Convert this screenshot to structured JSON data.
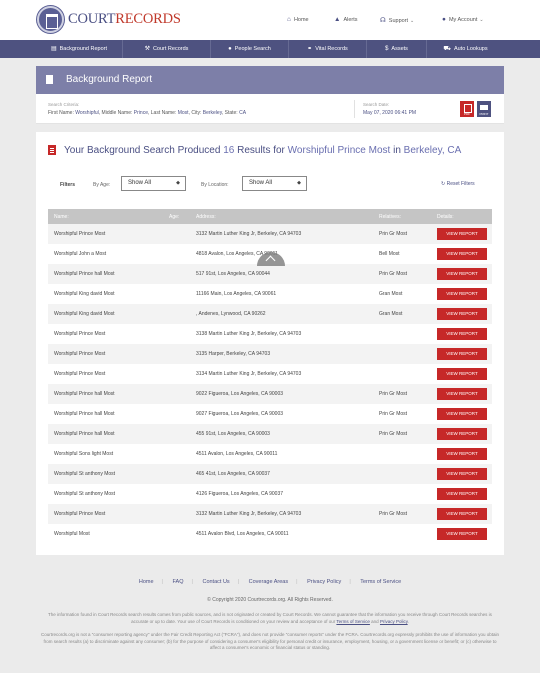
{
  "header": {
    "logo_part1": "COURT",
    "logo_part2": "RECORDS",
    "nav": [
      {
        "label": "Home",
        "icon": "home-icon"
      },
      {
        "label": "Alerts",
        "icon": "alert-icon"
      },
      {
        "label": "Support",
        "icon": "headset-icon"
      },
      {
        "label": "My Account",
        "icon": "user-icon"
      }
    ]
  },
  "main_nav": [
    {
      "label": "Background Report",
      "icon": "document-icon"
    },
    {
      "label": "Court Records",
      "icon": "gavel-icon"
    },
    {
      "label": "People Search",
      "icon": "person-icon"
    },
    {
      "label": "Vital Records",
      "icon": "link-icon"
    },
    {
      "label": "Assets",
      "icon": "dollar-icon"
    },
    {
      "label": "Auto Lookups",
      "icon": "car-icon"
    }
  ],
  "report": {
    "title": "Background Report",
    "criteria_label": "Search Criteria:",
    "criteria": {
      "first_name_label": "First Name:",
      "first_name": "Worshipful",
      "middle_name_label": "Middle Name:",
      "middle_name": "Prince",
      "last_name_label": "Last Name:",
      "last_name": "Most",
      "city_label": "City:",
      "city": "Berkeley",
      "state_label": "State:",
      "state": "CA"
    },
    "date_label": "Search Date:",
    "date_value": "May 07, 2020 06:41 PM",
    "pdf_label": "PDF",
    "print_label": "PRINT"
  },
  "results": {
    "title_prefix": "Your Background Search Produced",
    "count": "16",
    "title_mid": "Results for",
    "query_name": "Worshipful Prince Most",
    "title_in": "in",
    "query_location": "Berkeley, CA",
    "filters_label": "Filters",
    "by_age_label": "By Age:",
    "by_age_value": "Show All",
    "by_location_label": "By Location:",
    "by_location_value": "Show All",
    "reset_label": "Reset Filters",
    "columns": [
      "Name:",
      "Age:",
      "Address:",
      "Relatives:",
      "Details:"
    ],
    "view_label": "VIEW REPORT",
    "rows": [
      {
        "name": "Worshipful Prince Most",
        "address": "3132 Martin Luther King Jr, Berkeley, CA 94703",
        "relatives": "Prin Gr Most"
      },
      {
        "name": "Worshipful John a Most",
        "address": "4818 Avalon, Los Angeles, CA 90011",
        "relatives": "Bell Most"
      },
      {
        "name": "Worshipful Prince hall Most",
        "address": "517 91st, Los Angeles, CA 90044",
        "relatives": "Prin Gr Most"
      },
      {
        "name": "Worshipful King david Most",
        "address": "11166 Main, Los Angeles, CA 90061",
        "relatives": "Gran Most"
      },
      {
        "name": "Worshipful King david Most",
        "address": ", Andenes, Lynwood, CA 90262",
        "relatives": "Gran Most"
      },
      {
        "name": "Worshipful Prince Most",
        "address": "3138 Martin Luther King Jr, Berkeley, CA 94703",
        "relatives": ""
      },
      {
        "name": "Worshipful Prince Most",
        "address": "3135 Harper, Berkeley, CA 94703",
        "relatives": ""
      },
      {
        "name": "Worshipful Prince Most",
        "address": "3134 Martin Luther King Jr, Berkeley, CA 94703",
        "relatives": ""
      },
      {
        "name": "Worshipful Prince hall Most",
        "address": "9022 Figueroa, Los Angeles, CA 90003",
        "relatives": "Prin Gr Most"
      },
      {
        "name": "Worshipful Prince hall Most",
        "address": "9027 Figueroa, Los Angeles, CA 90003",
        "relatives": "Prin Gr Most"
      },
      {
        "name": "Worshipful Prince hall Most",
        "address": "455 91st, Los Angeles, CA 90003",
        "relatives": "Prin Gr Most"
      },
      {
        "name": "Worshipful Sons light Most",
        "address": "4511 Avalon, Los Angeles, CA 90011",
        "relatives": ""
      },
      {
        "name": "Worshipful St anthony Most",
        "address": "465 41st, Los Angeles, CA 90037",
        "relatives": ""
      },
      {
        "name": "Worshipful St anthony Most",
        "address": "4126 Figueroa, Los Angeles, CA 90037",
        "relatives": ""
      },
      {
        "name": "Worshipful Prince Most",
        "address": "3132 Martin Luther King Jr, Berkeley, CA 94703",
        "relatives": "Prin Gr Most"
      },
      {
        "name": "Worshipful Most",
        "address": "4511 Avalon Blvd, Los Angeles, CA 90011",
        "relatives": ""
      }
    ]
  },
  "footer": {
    "links": [
      "Home",
      "FAQ",
      "Contact Us",
      "Coverage Areas",
      "Privacy Policy",
      "Terms of Service"
    ],
    "copyright": "© Copyright 2020 Courtrecords.org. All Rights Reserved.",
    "disclaimer1_pre": "The information found in Court Records search results comes from public sources, and is not originated or created by Court Records. We cannot guarantee that the information you receive through Court Records searches is accurate or up to date. Your use of Court Records is conditioned on your review and acceptance of our",
    "disclaimer1_link1": "Terms of Service",
    "disclaimer1_and": "and",
    "disclaimer1_link2": "Privacy Policy",
    "disclaimer2": "Courtrecords.org is not a \"consumer reporting agency\" under the Fair Credit Reporting Act (\"FCRA\"), and does not provide \"consumer reports\" under the FCRA. Courtrecords.org expressly prohibits the use of information you obtain from search results (a) to discriminate against any consumer; (b) for the purpose of considering a consumer's eligibility for personal credit or insurance, employment, housing, or a government license or benefit; or (c) otherwise to affect a consumer's economic or financial status or standing."
  },
  "colors": {
    "brand": "#4e5280",
    "accent_red": "#c62828",
    "banner": "#7d7fa8"
  }
}
